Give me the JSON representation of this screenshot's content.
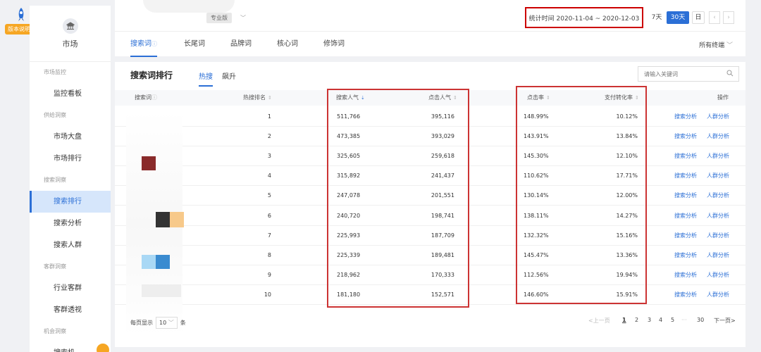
{
  "version_badge": {
    "label": "版本说明",
    "icon": "rocket-icon"
  },
  "sidebar": {
    "title": "市场",
    "icon": "bank-icon",
    "sections": [
      {
        "group": "市场监控",
        "items": [
          "监控看板"
        ]
      },
      {
        "group": "供给洞察",
        "items": [
          "市场大盘",
          "市场排行"
        ]
      },
      {
        "group": "搜索洞察",
        "items": [
          "搜索排行",
          "搜索分析",
          "搜索人群"
        ]
      },
      {
        "group": "客群洞察",
        "items": [
          "行业客群",
          "客群透视"
        ]
      },
      {
        "group": "机会洞察",
        "items": [
          "搜索机"
        ]
      }
    ],
    "active_item": "搜索排行"
  },
  "header": {
    "edition": "专业版",
    "date_range": "统计时间 2020-11-04 ~ 2020-12-03",
    "range_buttons": [
      "7天",
      "30天",
      "日"
    ],
    "active_range": "30天",
    "prev_icon": "chevron-left-icon",
    "next_icon": "chevron-right-icon",
    "tabs": [
      "搜索词",
      "长尾词",
      "品牌词",
      "核心词",
      "修饰词"
    ],
    "active_tab": "搜索词",
    "terminal": "所有终端"
  },
  "panel": {
    "title": "搜索词排行",
    "tabs": [
      "热搜",
      "飙升"
    ],
    "active_tab": "热搜",
    "search_placeholder": "请输入关键词",
    "columns": {
      "keyword": "搜索词",
      "rank": "热搜排名",
      "search_pop": "搜索人气",
      "click_pop": "点击人气",
      "ctr": "点击率",
      "cvr": "支付转化率",
      "ops": "操作"
    },
    "rows": [
      {
        "rank": "1",
        "search_pop": "511,766",
        "click_pop": "395,116",
        "ctr": "148.99%",
        "cvr": "10.12%"
      },
      {
        "rank": "2",
        "search_pop": "473,385",
        "click_pop": "393,029",
        "ctr": "143.91%",
        "cvr": "13.84%"
      },
      {
        "rank": "3",
        "search_pop": "325,605",
        "click_pop": "259,618",
        "ctr": "145.30%",
        "cvr": "12.10%"
      },
      {
        "rank": "4",
        "search_pop": "315,892",
        "click_pop": "241,437",
        "ctr": "110.62%",
        "cvr": "17.71%"
      },
      {
        "rank": "5",
        "search_pop": "247,078",
        "click_pop": "201,551",
        "ctr": "130.14%",
        "cvr": "12.00%"
      },
      {
        "rank": "6",
        "search_pop": "240,720",
        "click_pop": "198,741",
        "ctr": "138.11%",
        "cvr": "14.27%"
      },
      {
        "rank": "7",
        "search_pop": "225,993",
        "click_pop": "187,709",
        "ctr": "132.32%",
        "cvr": "15.16%"
      },
      {
        "rank": "8",
        "search_pop": "225,339",
        "click_pop": "189,481",
        "ctr": "145.47%",
        "cvr": "13.36%"
      },
      {
        "rank": "9",
        "search_pop": "218,962",
        "click_pop": "170,333",
        "ctr": "112.56%",
        "cvr": "19.94%"
      },
      {
        "rank": "10",
        "search_pop": "181,180",
        "click_pop": "152,571",
        "ctr": "146.60%",
        "cvr": "15.91%"
      }
    ],
    "action_labels": [
      "搜索分析",
      "人群分析"
    ],
    "page_size_label": "每页显示",
    "page_size": "10",
    "page_size_unit": "条",
    "pager": {
      "prev": "<上一页",
      "pages": [
        "1",
        "2",
        "3",
        "4",
        "5"
      ],
      "ellipsis": "···",
      "last": "30",
      "next": "下一页>"
    }
  },
  "colors": {
    "accent": "#2b6fd6",
    "highlight_box": "#cc3333",
    "badge": "#f6a623"
  }
}
